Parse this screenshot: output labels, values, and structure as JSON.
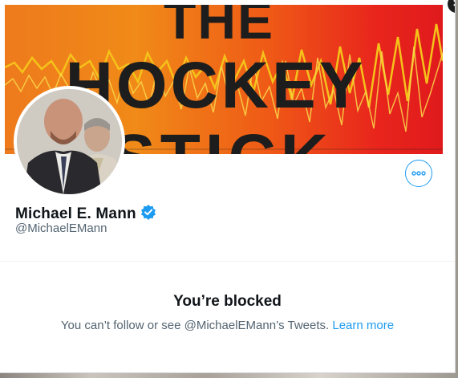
{
  "banner": {
    "line1": "THE",
    "line2": "HOCKEY",
    "line3": "STICK"
  },
  "profile": {
    "display_name": "Michael E. Mann",
    "handle": "@MichaelEMann",
    "verified": true
  },
  "actions": {
    "more_icon": "more-horizontal-icon",
    "close_icon": "close-icon"
  },
  "blocked": {
    "title": "You’re blocked",
    "description": "You can’t follow or see @MichaelEMann’s Tweets.",
    "learn_more": "Learn more"
  },
  "colors": {
    "accent": "#1d9bf0",
    "text_primary": "#0f1419",
    "text_secondary": "#536471",
    "banner_orange": "#ef7b1c",
    "banner_red": "#e01a1c"
  }
}
